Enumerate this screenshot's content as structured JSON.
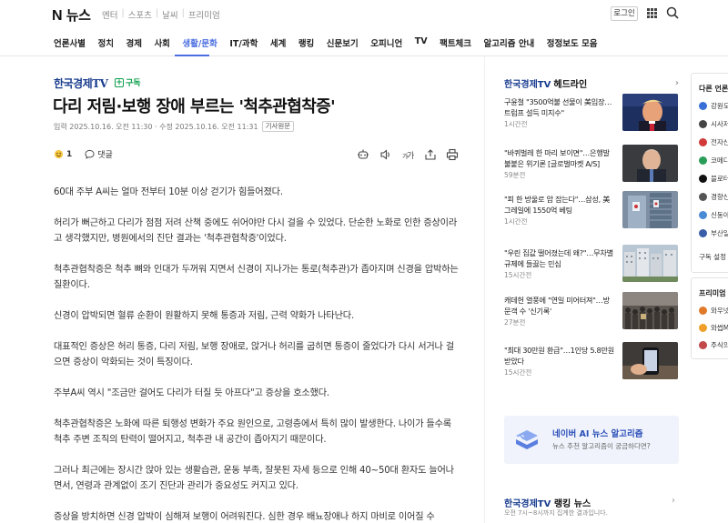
{
  "topbar": {
    "logo_n": "N",
    "logo_text": "뉴스",
    "links": [
      "엔터",
      "스포츠",
      "날씨",
      "프리미엄"
    ],
    "login": "로그인"
  },
  "nav": {
    "items": [
      "언론사별",
      "정치",
      "경제",
      "사회",
      "생활/문화",
      "IT/과학",
      "세계",
      "랭킹",
      "신문보기",
      "오피니언",
      "TV",
      "팩트체크",
      "알고리즘 안내",
      "정정보도 모음"
    ],
    "active": "생활/문화"
  },
  "article": {
    "press": "한국경제TV",
    "subscribe": "구독",
    "headline": "다리 저림·보행 장애 부르는 '척추관협착증'",
    "dates": "입력 2025.10.16. 오전 11:30 · 수정 2025.10.16. 오전 11:31",
    "original_btn": "기사원문",
    "reaction_count": "1",
    "comment_label": "댓글",
    "paragraphs": [
      "60대 주부 A씨는 얼마 전부터 10분 이상 걷기가 힘들어졌다.",
      "허리가 뻐근하고 다리가 점점 저려 산책 중에도 쉬어야만 다시 걸을 수 있었다. 단순한 노화로 인한 증상이라고 생각했지만, 병원에서의 진단 결과는 '척추관협착증'이었다.",
      "척추관협착증은 척추 뼈와 인대가 두꺼워 지면서 신경이 지나가는 통로(척추관)가 좁아지며 신경을 압박하는 질환이다.",
      "신경이 압박되면 혈류 순환이 원활하지 못해 통증과 저림, 근력 약화가 나타난다.",
      "대표적인 증상은 허리 통증, 다리 저림, 보행 장애로, 앉거나 허리를 굽히면 통증이 줄었다가 다시 서거나 걸으면 증상이 악화되는 것이 특징이다.",
      "주부A씨 역시 \"조금만 걸어도 다리가 터질 듯 아프다\"고 증상을 호소했다.",
      "척추관협착증은 노화에 따른 퇴행성 변화가 주요 원인으로, 고령층에서 특히 많이 발생한다. 나이가 들수록 척추 주변 조직의 탄력이 떨어지고, 척추관 내 공간이 좁아지기 때문이다.",
      "그러나 최근에는 장시간 앉아 있는 생활습관, 운동 부족, 잘못된 자세 등으로 인해 40~50대 환자도 늘어나면서, 연령과 관계없이 조기 진단과 관리가 중요성도 커지고 있다.",
      "증상을 방치하면 신경 압박이 심해져 보행이 어려워진다. 심한 경우 배뇨장애나 하지 마비로 이어질 수"
    ]
  },
  "headlines": {
    "press": "한국경제TV",
    "title": "헤드라인",
    "items": [
      {
        "title": "구윤철 \"3500억불 선물이 美입장…트럼프 설득 미지수\"",
        "time": "1시간전",
        "thumb": "trump"
      },
      {
        "title": "\"바퀴벌레 한 마리 보이면\"…은행발 불붙은 위기론 [글로벌마켓 A/S]",
        "time": "59분전",
        "thumb": "dimon"
      },
      {
        "title": "\"피 한 방울로 암 잡는다\"…삼성, 美 그레일에 1550억 베팅",
        "time": "1시간전",
        "thumb": "samsung"
      },
      {
        "title": "\"우린 집값 떨어졌는데 왜?\"…무차별 규제에 들끓는 민심",
        "time": "15시간전",
        "thumb": "apartments"
      },
      {
        "title": "캐데헌 열풍에 \"연일 미어터져\"…방문객 수 '신기록'",
        "time": "27분전",
        "thumb": "crowd"
      },
      {
        "title": "\"최대 30만원 환급\"…1인당 5.8만원 받았다",
        "time": "15시간전",
        "thumb": "phone"
      }
    ]
  },
  "ai_box": {
    "title": "네이버 AI 뉴스 알고리즘",
    "subtitle": "뉴스 추천 알고리즘이 궁금하다면?"
  },
  "ranking": {
    "press": "한국경제TV",
    "title": "랭킹 뉴스",
    "subtitle": "오전 7시~8시까지 집계한 결과입니다."
  },
  "side_panel": {
    "title": "다른 언론사",
    "items": [
      "강원도",
      "시사저",
      "전자신",
      "코메디",
      "블로터",
      "경향신",
      "신동아",
      "부산일"
    ],
    "setting": "구독 설정",
    "premium_title": "프리미엄 콘",
    "premium_items": [
      "와우넷",
      "와썹M",
      "주식의"
    ]
  }
}
